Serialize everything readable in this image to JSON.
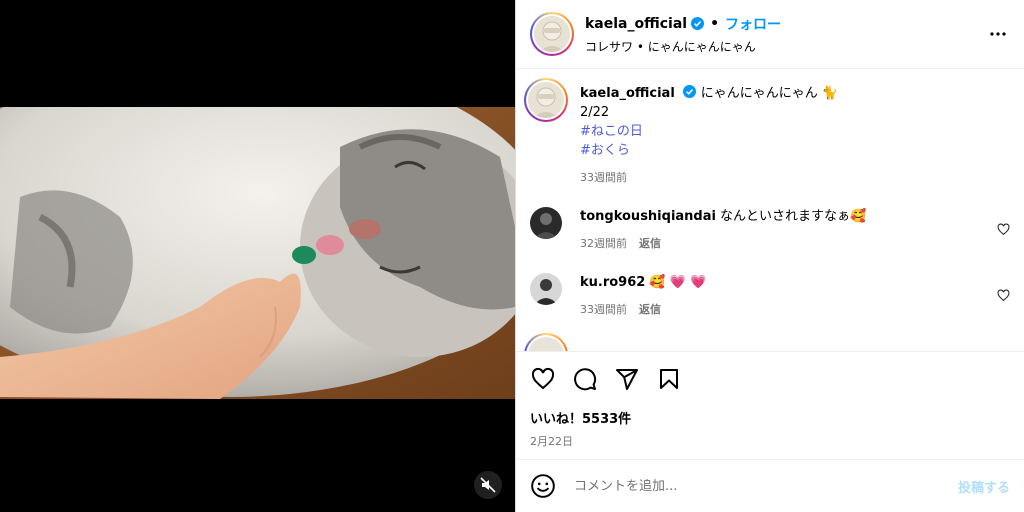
{
  "post": {
    "username": "kaela_official",
    "follow_label": "フォロー",
    "separator": "•",
    "location": "コレサワ • にゃんにゃんにゃん",
    "caption_text": "にゃんにゃんにゃん 🐈",
    "caption_date": "2/22",
    "hashtags": [
      "#ねこの日",
      "#おくら"
    ],
    "caption_time": "33週間前",
    "likes": "いいね！5533件",
    "date": "2月22日"
  },
  "comments": [
    {
      "username": "tongkoushiqiandai",
      "text": "なんといされますなぁ🥰",
      "time": "32週間前",
      "reply": "返信"
    },
    {
      "username": "ku.ro962",
      "text": "🥰 💗 💗",
      "time": "33週間前",
      "reply": "返信"
    },
    {
      "username": "...",
      "text": "",
      "time": "",
      "reply": ""
    }
  ],
  "add_comment": {
    "placeholder": "コメントを追加...",
    "post_label": "投稿する"
  },
  "icons": {
    "verified": "verified-badge-icon",
    "more": "more-options-icon",
    "like": "heart-icon",
    "comment": "comment-icon",
    "share": "share-icon",
    "save": "bookmark-icon",
    "emoji": "emoji-icon",
    "mute": "muted-speaker-icon"
  },
  "colors": {
    "accent": "#0095f6",
    "hashtag": "#4f5bd5",
    "muted": "#737373"
  }
}
